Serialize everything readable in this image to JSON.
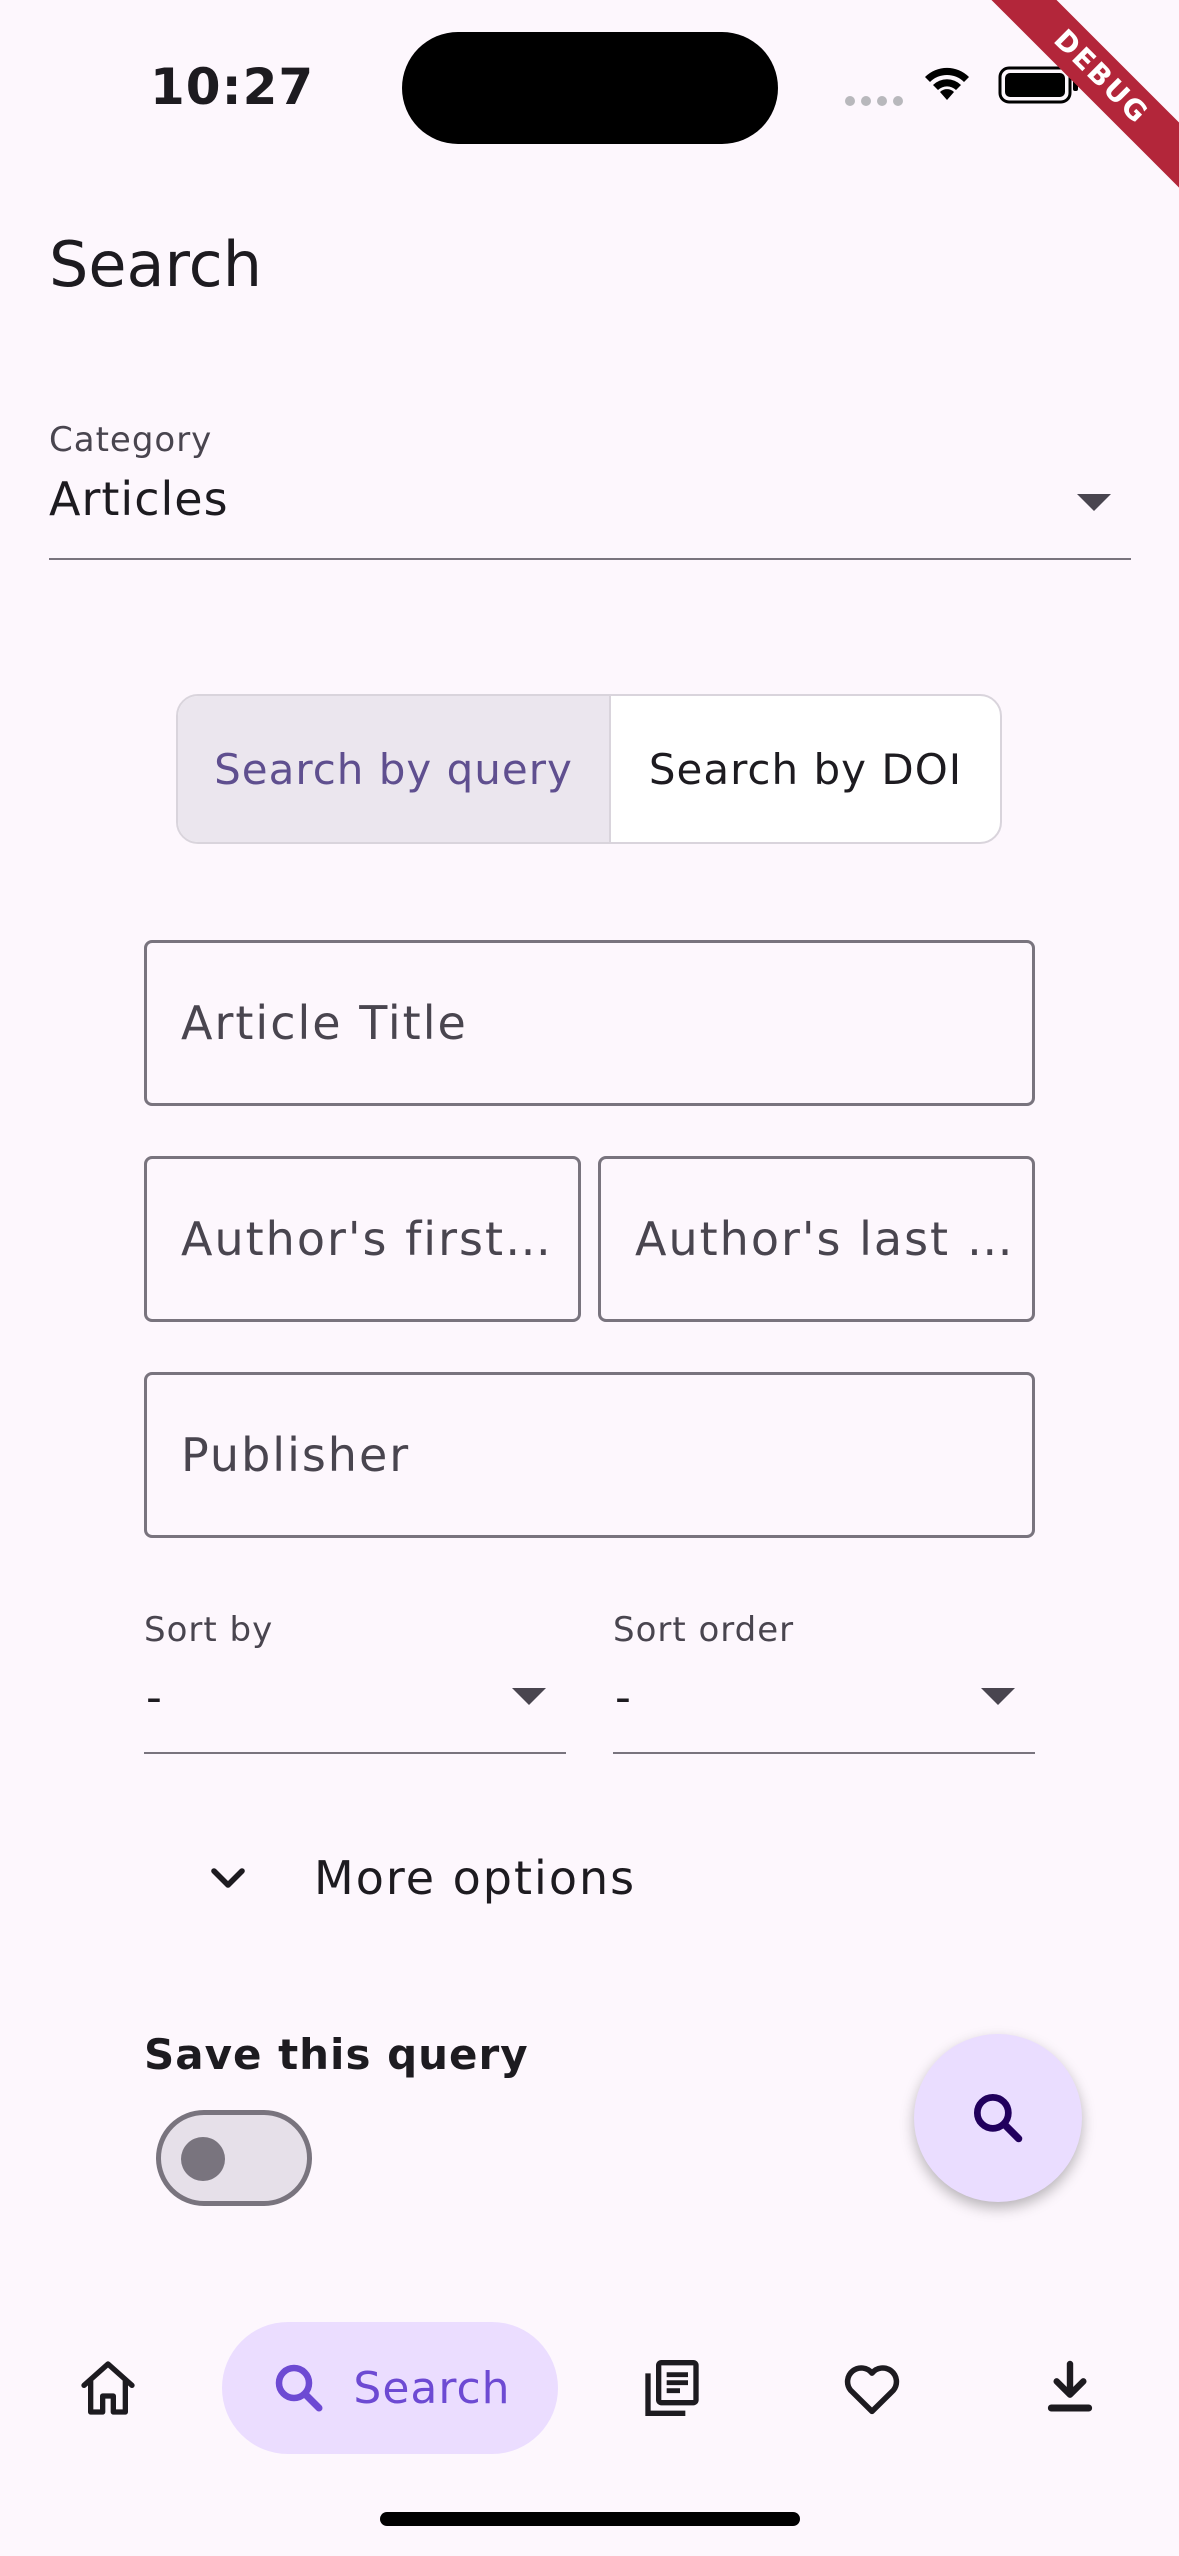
{
  "status_bar": {
    "time": "10:27",
    "debug_label": "DEBUG"
  },
  "page": {
    "title": "Search"
  },
  "category": {
    "label": "Category",
    "value": "Articles"
  },
  "segmented": {
    "query_label": "Search by query",
    "doi_label": "Search by DOI",
    "selected": "query"
  },
  "fields": {
    "title_placeholder": "Article Title",
    "author_first_placeholder": "Author's first…",
    "author_last_placeholder": "Author's last …",
    "publisher_placeholder": "Publisher"
  },
  "sort_by": {
    "label": "Sort by",
    "value": "-"
  },
  "sort_order": {
    "label": "Sort order",
    "value": "-"
  },
  "more_options": {
    "label": "More options"
  },
  "save_query": {
    "label": "Save this query",
    "enabled": false
  },
  "fab": {
    "icon": "search-icon"
  },
  "bottom_nav": {
    "items": [
      {
        "icon": "home-icon",
        "label": ""
      },
      {
        "icon": "search-icon",
        "label": "Search",
        "active": true
      },
      {
        "icon": "articles-icon",
        "label": ""
      },
      {
        "icon": "heart-icon",
        "label": ""
      },
      {
        "icon": "download-icon",
        "label": ""
      }
    ]
  },
  "colors": {
    "accent": "#6d4ad3",
    "accent_container": "#ebddff",
    "background": "#fdf7fd"
  }
}
